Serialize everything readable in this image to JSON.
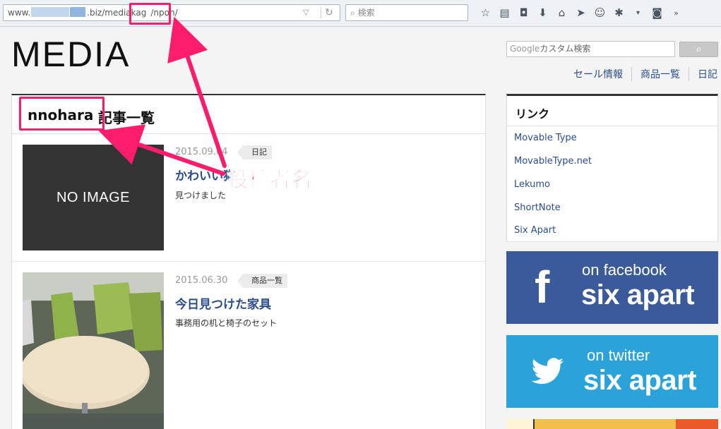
{
  "browser": {
    "url_prefix": "www.",
    "url_mid": ".biz/mediakag",
    "url_path": "/npon/",
    "search_placeholder": "検索"
  },
  "site": {
    "logo": "MEDIA",
    "search_placeholder": "カスタム検索",
    "search_brand": "Google",
    "nav": [
      "セール情報",
      "商品一覧",
      "日記"
    ]
  },
  "main": {
    "author": "nnohara",
    "heading_rest": "記事一覧",
    "entries": [
      {
        "date": "2015.09.04",
        "category": "日記",
        "title": "かわいい猫",
        "excerpt": "見つけました",
        "thumb": "NO IMAGE"
      },
      {
        "date": "2015.06.30",
        "category": "商品一覧",
        "title": "今日見つけた家具",
        "excerpt": "事務用の机と椅子のセット"
      }
    ]
  },
  "sidebar": {
    "heading": "リンク",
    "links": [
      "Movable Type",
      "MovableType.net",
      "Lekumo",
      "ShortNote",
      "Six Apart"
    ],
    "facebook": {
      "small": "on facebook",
      "big": "six apart",
      "color": "#3a5a99"
    },
    "twitter": {
      "small": "on twitter",
      "big": "six apart",
      "color": "#2aa3db"
    }
  },
  "annotation": {
    "label": "投稿者名",
    "color": "#ff1c6c"
  }
}
